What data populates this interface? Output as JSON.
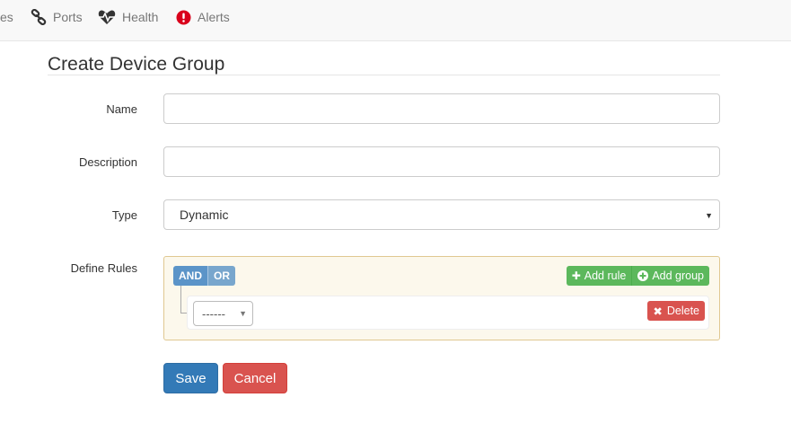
{
  "nav": {
    "items": [
      {
        "label": "es"
      },
      {
        "label": "Ports",
        "icon": "link-icon"
      },
      {
        "label": "Health",
        "icon": "heartbeat-icon"
      },
      {
        "label": "Alerts",
        "icon": "exclamation-circle-icon"
      }
    ]
  },
  "page": {
    "title": "Create Device Group"
  },
  "form": {
    "name": {
      "label": "Name",
      "value": ""
    },
    "description": {
      "label": "Description",
      "value": ""
    },
    "type": {
      "label": "Type",
      "selected": "Dynamic"
    },
    "rules": {
      "label": "Define Rules",
      "conditions": [
        "AND",
        "OR"
      ],
      "active_condition": "AND",
      "add_rule_label": "Add rule",
      "add_group_label": "Add group",
      "rule_field_placeholder": "------",
      "delete_label": "Delete"
    },
    "save_label": "Save",
    "cancel_label": "Cancel"
  },
  "colors": {
    "primary": "#337ab7",
    "danger": "#d9534f",
    "success": "#5cb85c",
    "condition": "#5b94c8",
    "alert_icon": "#d9001b"
  }
}
